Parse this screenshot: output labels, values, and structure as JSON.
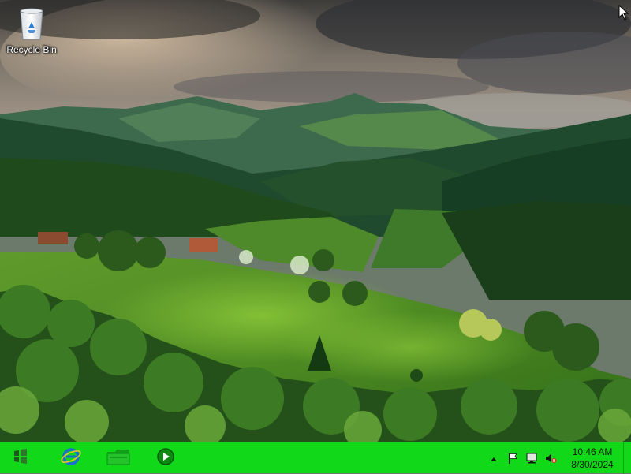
{
  "desktop": {
    "icons": [
      {
        "label": "Recycle Bin",
        "icon": "recycle-bin-icon"
      }
    ]
  },
  "taskbar": {
    "color": "#12d81a",
    "pinned": [
      {
        "name": "start",
        "icon": "windows-logo-icon"
      },
      {
        "name": "internet-explorer",
        "icon": "internet-explorer-icon"
      },
      {
        "name": "file-explorer",
        "icon": "folder-icon"
      },
      {
        "name": "media-player",
        "icon": "media-player-icon"
      }
    ],
    "tray": {
      "icons": [
        "show-hidden-icons-arrow",
        "action-center-flag-icon",
        "network-icon",
        "volume-muted-icon"
      ],
      "time": "10:46 AM",
      "date": "8/30/2024"
    }
  }
}
